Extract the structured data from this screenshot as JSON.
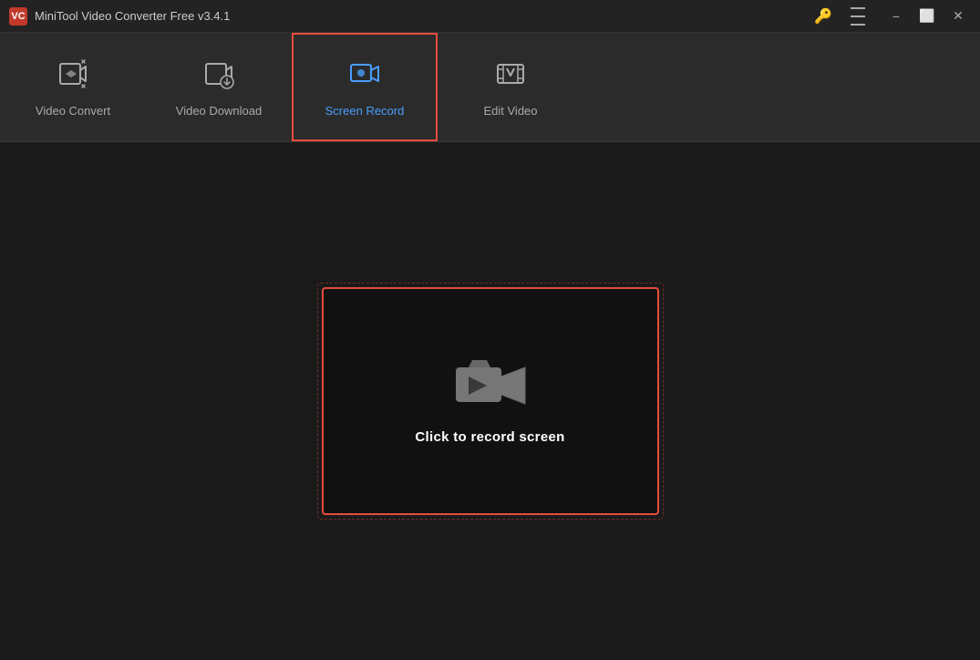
{
  "titlebar": {
    "logo_text": "VC",
    "title": "MiniTool Video Converter Free v3.4.1",
    "key_icon": "🔑",
    "minimize_label": "−",
    "restore_label": "⬜",
    "close_label": "✕"
  },
  "nav": {
    "items": [
      {
        "id": "video-convert",
        "label": "Video Convert",
        "active": false
      },
      {
        "id": "video-download",
        "label": "Video Download",
        "active": false
      },
      {
        "id": "screen-record",
        "label": "Screen Record",
        "active": true
      },
      {
        "id": "edit-video",
        "label": "Edit Video",
        "active": false
      }
    ]
  },
  "main": {
    "record_button_label": "Click to record screen"
  }
}
